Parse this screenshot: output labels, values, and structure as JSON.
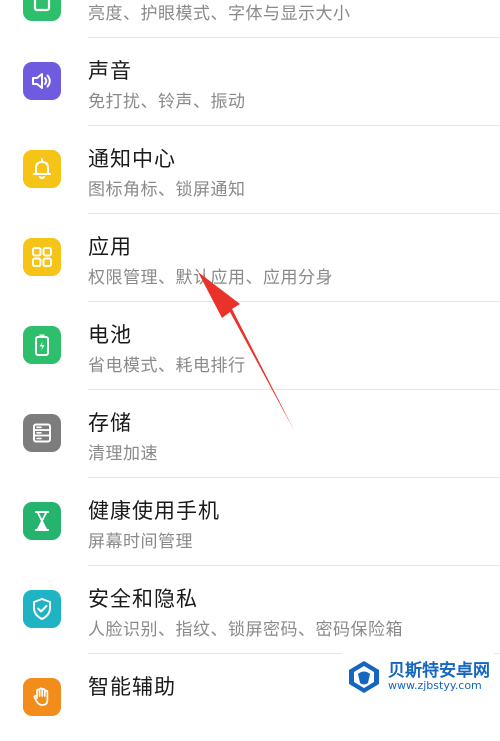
{
  "settings_items": [
    {
      "title": "",
      "subtitle": "亮度、护眼模式、字体与显示大小",
      "icon": "display-icon",
      "color": "#2dbf6b"
    },
    {
      "title": "声音",
      "subtitle": "免打扰、铃声、振动",
      "icon": "speaker-icon",
      "color": "#6f5be0"
    },
    {
      "title": "通知中心",
      "subtitle": "图标角标、锁屏通知",
      "icon": "bell-icon",
      "color": "#f6c417"
    },
    {
      "title": "应用",
      "subtitle": "权限管理、默认应用、应用分身",
      "icon": "grid-icon",
      "color": "#f6c417"
    },
    {
      "title": "电池",
      "subtitle": "省电模式、耗电排行",
      "icon": "battery-icon",
      "color": "#2dbf6b"
    },
    {
      "title": "存储",
      "subtitle": "清理加速",
      "icon": "storage-icon",
      "color": "#7d7d7d"
    },
    {
      "title": "健康使用手机",
      "subtitle": "屏幕时间管理",
      "icon": "hourglass-icon",
      "color": "#25b46e"
    },
    {
      "title": "安全和隐私",
      "subtitle": "人脸识别、指纹、锁屏密码、密码保险箱",
      "icon": "shield-icon",
      "color": "#1fb3c3"
    },
    {
      "title": "智能辅助",
      "subtitle": "",
      "icon": "hand-icon",
      "color": "#f28c1b"
    }
  ],
  "watermark": {
    "name": "贝斯特安卓网",
    "url": "www.zjbstyy.com"
  },
  "colors": {
    "annotation_arrow": "#e8322a",
    "divider": "#e6e6e6"
  }
}
